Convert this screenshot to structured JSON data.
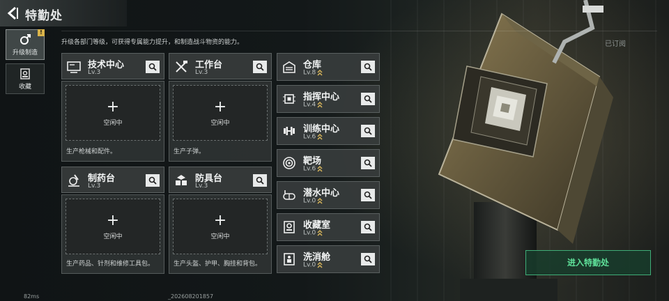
{
  "header": {
    "title": "特勤处"
  },
  "nav": [
    {
      "label": "升级制造",
      "badge": "!"
    },
    {
      "label": "收藏"
    }
  ],
  "subtitle": "升级各部门等级，可获得专属能力提升，和制造战斗物资的能力。",
  "subscribed": "已订阅",
  "enter_button": "进入特勤处",
  "slot_plus": "+",
  "slot_idle": "空闲中",
  "production_units": [
    {
      "name": "技术中心",
      "level": "Lv.3",
      "icon": "computer-icon",
      "desc": "生产枪械和配件。"
    },
    {
      "name": "工作台",
      "level": "Lv.3",
      "icon": "tools-icon",
      "desc": "生产子弹。"
    },
    {
      "name": "制药台",
      "level": "Lv.3",
      "icon": "microscope-icon",
      "desc": "生产药品、针剂和维修工具包。"
    },
    {
      "name": "防具台",
      "level": "Lv.3",
      "icon": "armor-icon",
      "desc": "生产头盔、护甲、胸挂和背包。"
    }
  ],
  "facilities": [
    {
      "name": "仓库",
      "level": "Lv.8",
      "icon": "warehouse-icon"
    },
    {
      "name": "指挥中心",
      "level": "Lv.4",
      "icon": "chip-icon"
    },
    {
      "name": "训练中心",
      "level": "Lv.6",
      "icon": "dumbbell-icon"
    },
    {
      "name": "靶场",
      "level": "Lv.6",
      "icon": "target-icon"
    },
    {
      "name": "潜水中心",
      "level": "Lv.0",
      "icon": "diving-icon"
    },
    {
      "name": "收藏室",
      "level": "Lv.0",
      "icon": "collection-icon"
    },
    {
      "name": "洗消舱",
      "level": "Lv.0",
      "icon": "decontamination-icon"
    }
  ],
  "footer": {
    "ping": "82ms",
    "version": "_202608201857"
  },
  "colors": {
    "accent_green": "#5fe19a",
    "badge_yellow": "#d9b34a",
    "upgrade_gold": "#d6b45a"
  }
}
